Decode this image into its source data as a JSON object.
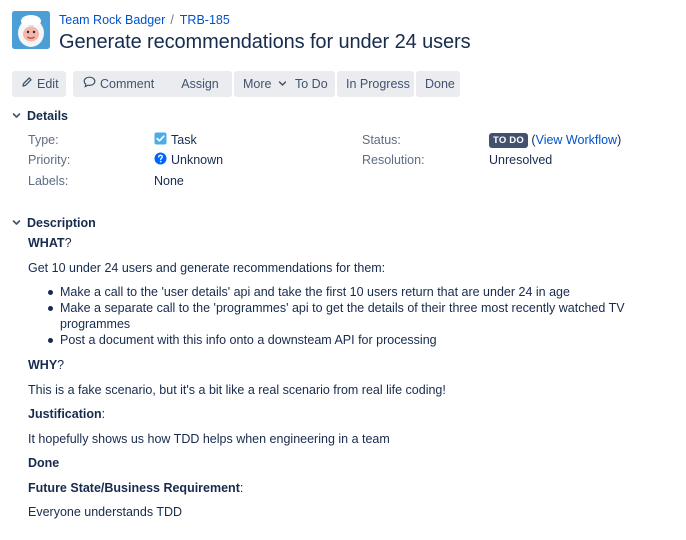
{
  "breadcrumb": {
    "project": "Team Rock Badger",
    "separator": "/",
    "issue_key": "TRB-185"
  },
  "issue": {
    "title": "Generate recommendations for under 24 users"
  },
  "toolbar": {
    "edit": "Edit",
    "comment": "Comment",
    "assign": "Assign",
    "more": "More",
    "todo": "To Do",
    "in_progress": "In Progress",
    "done": "Done"
  },
  "details": {
    "heading": "Details",
    "type_label": "Type:",
    "type_value": "Task",
    "priority_label": "Priority:",
    "priority_value": "Unknown",
    "labels_label": "Labels:",
    "labels_value": "None",
    "status_label": "Status:",
    "status_value": "TO DO",
    "status_open": "(",
    "status_link": "View Workflow",
    "status_close": ")",
    "resolution_label": "Resolution:",
    "resolution_value": "Unresolved"
  },
  "description": {
    "heading": "Description",
    "what_heading": "WHAT",
    "what_q": "?",
    "intro": "Get 10 under 24 users and generate recommendations for them:",
    "bullets": [
      "Make a call to the 'user details' api and take the first 10 users return that are under 24 in age",
      "Make a separate call to the 'programmes' api to get the details of their three most recently watched TV programmes",
      "Post a document with this info onto a downsteam API for processing"
    ],
    "why_heading": "WHY",
    "why_q": "?",
    "why_text": "This is a fake scenario, but it's a bit like a real scenario from real life coding!",
    "justification_heading": "Justification",
    "justification_colon": ":",
    "justification_text": "It hopefully shows us how TDD helps when engineering in a team",
    "done_heading": "Done",
    "future_heading": "Future State/Business Requirement",
    "future_colon": ":",
    "future_text": "Everyone understands TDD"
  },
  "colors": {
    "link": "#0052cc",
    "text": "#172b4d",
    "muted": "#5e6c84",
    "button_bg": "#ebecf0",
    "lozenge_bg": "#42526e",
    "task_icon": "#4bade8",
    "priority_icon": "#0065ff"
  },
  "icons": {
    "avatar": "yeti-avatar-icon",
    "edit": "pencil-icon",
    "comment": "speech-bubble-icon",
    "more": "chevron-down-icon",
    "section": "chevron-down-icon",
    "type": "task-checkbox-icon",
    "priority": "question-mark-icon"
  }
}
